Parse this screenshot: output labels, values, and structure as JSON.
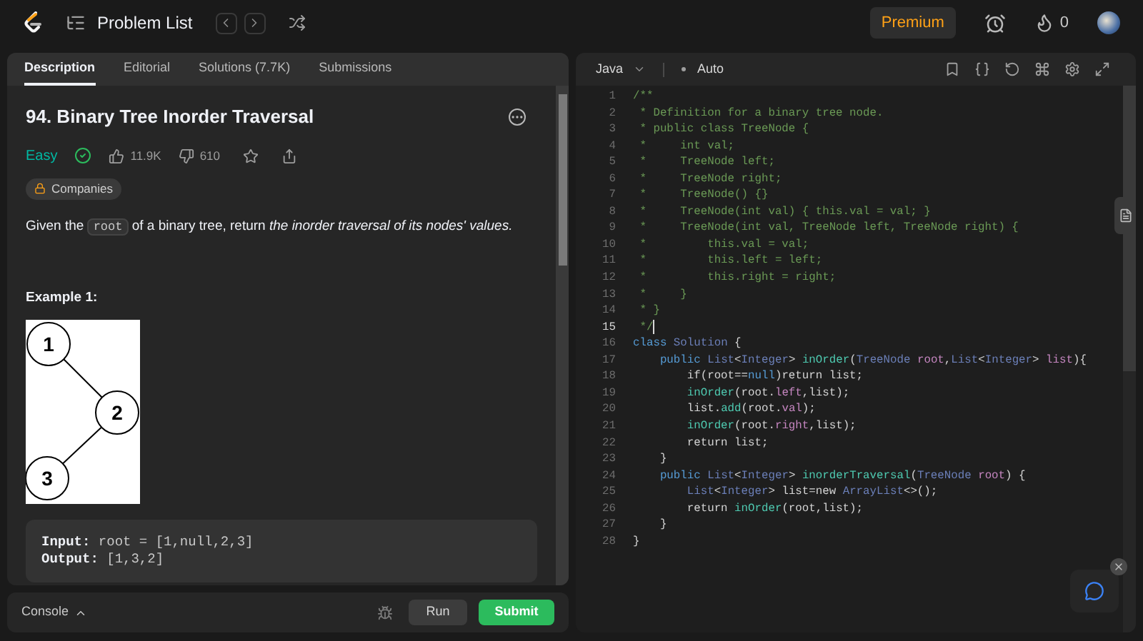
{
  "topbar": {
    "title": "Problem List",
    "premium": "Premium",
    "streak": "0"
  },
  "tabs": [
    {
      "label": "Description",
      "selected": true
    },
    {
      "label": "Editorial",
      "selected": false
    },
    {
      "label": "Solutions (7.7K)",
      "selected": false
    },
    {
      "label": "Submissions",
      "selected": false
    }
  ],
  "problem": {
    "title": "94. Binary Tree Inorder Traversal",
    "difficulty": "Easy",
    "solved": true,
    "likes": "11.9K",
    "dislikes": "610",
    "companies": "Companies",
    "description": [
      {
        "text": "Given the ",
        "kind": "plain"
      },
      {
        "text": "root",
        "kind": "code"
      },
      {
        "text": " of a binary tree, return ",
        "kind": "plain"
      },
      {
        "text": "the inorder traversal of its nodes' values.",
        "kind": "italic"
      }
    ],
    "example_title": "Example 1:",
    "tree_nodes": [
      "1",
      "2",
      "3"
    ],
    "example": [
      {
        "label": "Input:",
        "value": "root = [1,null,2,3]"
      },
      {
        "label": "Output:",
        "value": "[1,3,2]"
      }
    ]
  },
  "console": {
    "label": "Console",
    "run": "Run",
    "submit": "Submit"
  },
  "editor": {
    "language": "Java",
    "mode": "Auto",
    "lines": [
      {
        "number": "1",
        "active": false,
        "tokens": [
          {
            "text": "/**",
            "kind": "comment"
          }
        ]
      },
      {
        "number": "2",
        "active": false,
        "tokens": [
          {
            "text": " * Definition for a binary tree node.",
            "kind": "comment"
          }
        ]
      },
      {
        "number": "3",
        "active": false,
        "tokens": [
          {
            "text": " * public class TreeNode {",
            "kind": "comment"
          }
        ]
      },
      {
        "number": "4",
        "active": false,
        "tokens": [
          {
            "text": " *     int val;",
            "kind": "comment"
          }
        ]
      },
      {
        "number": "5",
        "active": false,
        "tokens": [
          {
            "text": " *     TreeNode left;",
            "kind": "comment"
          }
        ]
      },
      {
        "number": "6",
        "active": false,
        "tokens": [
          {
            "text": " *     TreeNode right;",
            "kind": "comment"
          }
        ]
      },
      {
        "number": "7",
        "active": false,
        "tokens": [
          {
            "text": " *     TreeNode() {}",
            "kind": "comment"
          }
        ]
      },
      {
        "number": "8",
        "active": false,
        "tokens": [
          {
            "text": " *     TreeNode(int val) { this.val = val; }",
            "kind": "comment"
          }
        ]
      },
      {
        "number": "9",
        "active": false,
        "tokens": [
          {
            "text": " *     TreeNode(int val, TreeNode left, TreeNode right) {",
            "kind": "comment"
          }
        ]
      },
      {
        "number": "10",
        "active": false,
        "tokens": [
          {
            "text": " *         this.val = val;",
            "kind": "comment"
          }
        ]
      },
      {
        "number": "11",
        "active": false,
        "tokens": [
          {
            "text": " *         this.left = left;",
            "kind": "comment"
          }
        ]
      },
      {
        "number": "12",
        "active": false,
        "tokens": [
          {
            "text": " *         this.right = right;",
            "kind": "comment"
          }
        ]
      },
      {
        "number": "13",
        "active": false,
        "tokens": [
          {
            "text": " *     }",
            "kind": "comment"
          }
        ]
      },
      {
        "number": "14",
        "active": false,
        "tokens": [
          {
            "text": " * }",
            "kind": "comment"
          }
        ]
      },
      {
        "number": "15",
        "active": true,
        "tokens": [
          {
            "text": " */",
            "kind": "comment"
          }
        ]
      },
      {
        "number": "16",
        "active": false,
        "tokens": [
          {
            "text": "class",
            "kind": "keyword"
          },
          {
            "text": " Solution",
            "kind": "type"
          },
          {
            "text": " {",
            "kind": "plain"
          }
        ]
      },
      {
        "number": "17",
        "active": false,
        "tokens": [
          {
            "text": "    public",
            "kind": "keyword"
          },
          {
            "text": " List",
            "kind": "type"
          },
          {
            "text": "<",
            "kind": "plain"
          },
          {
            "text": "Integer",
            "kind": "type"
          },
          {
            "text": "> ",
            "kind": "plain"
          },
          {
            "text": "inOrder",
            "kind": "function"
          },
          {
            "text": "(",
            "kind": "plain"
          },
          {
            "text": "TreeNode",
            "kind": "type"
          },
          {
            "text": " root",
            "kind": "variable"
          },
          {
            "text": ",",
            "kind": "plain"
          },
          {
            "text": "List",
            "kind": "type"
          },
          {
            "text": "<",
            "kind": "plain"
          },
          {
            "text": "Integer",
            "kind": "type"
          },
          {
            "text": "> ",
            "kind": "plain"
          },
          {
            "text": "list",
            "kind": "variable"
          },
          {
            "text": "){",
            "kind": "plain"
          }
        ]
      },
      {
        "number": "18",
        "active": false,
        "tokens": [
          {
            "text": "        if(root==",
            "kind": "plain"
          },
          {
            "text": "null",
            "kind": "keyword"
          },
          {
            "text": ")return list;",
            "kind": "plain"
          }
        ]
      },
      {
        "number": "19",
        "active": false,
        "tokens": [
          {
            "text": "        inOrder",
            "kind": "function"
          },
          {
            "text": "(root.",
            "kind": "plain"
          },
          {
            "text": "left",
            "kind": "variable"
          },
          {
            "text": ",list);",
            "kind": "plain"
          }
        ]
      },
      {
        "number": "20",
        "active": false,
        "tokens": [
          {
            "text": "        list.",
            "kind": "plain"
          },
          {
            "text": "add",
            "kind": "function"
          },
          {
            "text": "(root.",
            "kind": "plain"
          },
          {
            "text": "val",
            "kind": "variable"
          },
          {
            "text": ");",
            "kind": "plain"
          }
        ]
      },
      {
        "number": "21",
        "active": false,
        "tokens": [
          {
            "text": "        inOrder",
            "kind": "function"
          },
          {
            "text": "(root.",
            "kind": "plain"
          },
          {
            "text": "right",
            "kind": "variable"
          },
          {
            "text": ",list);",
            "kind": "plain"
          }
        ]
      },
      {
        "number": "22",
        "active": false,
        "tokens": [
          {
            "text": "        return list;",
            "kind": "plain"
          }
        ]
      },
      {
        "number": "23",
        "active": false,
        "tokens": [
          {
            "text": "    }",
            "kind": "plain"
          }
        ]
      },
      {
        "number": "24",
        "active": false,
        "tokens": [
          {
            "text": "    public",
            "kind": "keyword"
          },
          {
            "text": " List",
            "kind": "type"
          },
          {
            "text": "<",
            "kind": "plain"
          },
          {
            "text": "Integer",
            "kind": "type"
          },
          {
            "text": "> ",
            "kind": "plain"
          },
          {
            "text": "inorderTraversal",
            "kind": "function"
          },
          {
            "text": "(",
            "kind": "plain"
          },
          {
            "text": "TreeNode",
            "kind": "type"
          },
          {
            "text": " root",
            "kind": "variable"
          },
          {
            "text": ") {",
            "kind": "plain"
          }
        ]
      },
      {
        "number": "25",
        "active": false,
        "tokens": [
          {
            "text": "        List",
            "kind": "type"
          },
          {
            "text": "<",
            "kind": "plain"
          },
          {
            "text": "Integer",
            "kind": "type"
          },
          {
            "text": "> list=new ",
            "kind": "plain"
          },
          {
            "text": "ArrayList",
            "kind": "type"
          },
          {
            "text": "<>();",
            "kind": "plain"
          }
        ]
      },
      {
        "number": "26",
        "active": false,
        "tokens": [
          {
            "text": "        return ",
            "kind": "plain"
          },
          {
            "text": "inOrder",
            "kind": "function"
          },
          {
            "text": "(root,list);",
            "kind": "plain"
          }
        ]
      },
      {
        "number": "27",
        "active": false,
        "tokens": [
          {
            "text": "    }",
            "kind": "plain"
          }
        ]
      },
      {
        "number": "28",
        "active": false,
        "tokens": [
          {
            "text": "}",
            "kind": "plain"
          }
        ]
      }
    ]
  }
}
